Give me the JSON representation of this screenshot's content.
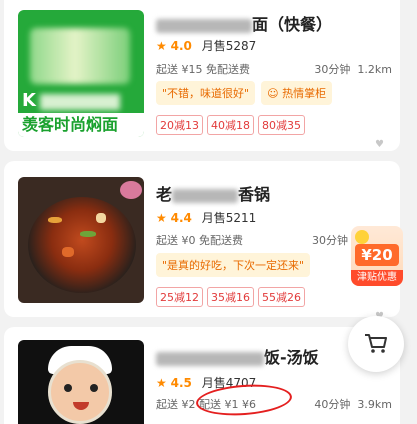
{
  "stores": [
    {
      "name_suffix": "面（快餐）",
      "rating": "4.0",
      "monthly_sales": "月售5287",
      "min_order": "起送 ¥15",
      "delivery_fee": "免配送费",
      "delivery_time": "30分钟",
      "distance": "1.2km",
      "quote": "\"不错，味道很好\"",
      "hot_tag": "热情掌柜",
      "promos": [
        "20减13",
        "40减18",
        "80减35"
      ],
      "thumb_caption": "羡客时尚焖面"
    },
    {
      "name_suffix": "香锅",
      "rating": "4.4",
      "monthly_sales": "月售5211",
      "min_order": "起送 ¥0",
      "delivery_fee": "免配送费",
      "delivery_time": "30分钟",
      "distance": "",
      "quote": "\"是真的好吃，下次一定还来\"",
      "hot_tag": "",
      "promos": [
        "25减12",
        "35减16",
        "55减26"
      ],
      "name_prefix": "老"
    },
    {
      "name_suffix": "饭-汤饭",
      "rating": "4.5",
      "monthly_sales": "月售4707",
      "min_order": "起送 ¥2",
      "delivery_fee": "配送 ¥1 ¥6",
      "delivery_time": "40分钟",
      "distance": "3.9km"
    }
  ],
  "subsidy": {
    "amount": "¥20",
    "label": "津贴优惠"
  },
  "colors": {
    "accent": "#ff8a00",
    "promo_red": "#e23b3b",
    "annotation_red": "#e41f1f"
  }
}
